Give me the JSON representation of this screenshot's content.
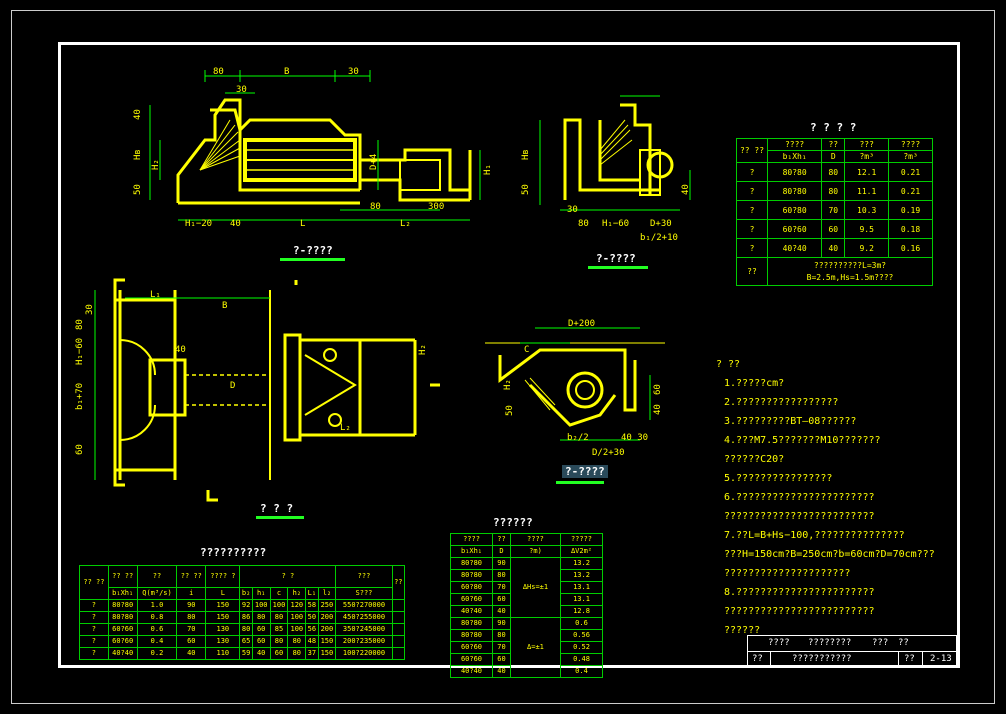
{
  "colors": {
    "line": "#ffff00",
    "dim": "#00ff00",
    "frame": "#ffffff",
    "accent": "#33ff33"
  },
  "views": {
    "elevation_label": "?-????",
    "side_label": "?-????",
    "plan_label": "? ? ?",
    "section_label": "?-????"
  },
  "dims": {
    "top_80": "80",
    "top_B": "B",
    "top_30a": "30",
    "top_30b": "30",
    "left_40": "40",
    "left_50": "50",
    "Hb": "Hв",
    "H2": "H₂",
    "H1": "H₁",
    "D4": "D+4",
    "Hl20": "H₁−20",
    "v40": "40",
    "L": "L",
    "L2": "L₂",
    "v80": "80",
    "v300": "300",
    "s_Hb": "Hв",
    "s_50": "50",
    "s_30": "30",
    "s_80": "80",
    "s_H60": "H₁−60",
    "s_D30": "D+30",
    "s_b2": "b₁/2+10",
    "s_40": "40",
    "p_80": "80",
    "p_30": "30",
    "p_60": "60",
    "p_L1": "L₁",
    "p_B": "B",
    "p_b70": "b₁+70",
    "p_H60": "H₁−60",
    "p_D": "D",
    "p_40": "40",
    "p_H2": "H₂",
    "p_L2": "L₂",
    "x_D200": "D+200",
    "x_C": "C",
    "x_H2": "H₂",
    "x_50": "50",
    "x_60": "60",
    "x_40": "40",
    "x_b2": "b₂/2",
    "x_4030": "40 30",
    "x_D230": "D/2+30"
  },
  "table_tr": {
    "title": "? ? ? ?",
    "headers": [
      "????",
      "??",
      "???",
      "????"
    ],
    "header_left": "??\n??",
    "subheaders": [
      "b₁Xh₁",
      "D",
      "?m³",
      "?m³"
    ],
    "rows": [
      [
        "?",
        "80?80",
        "80",
        "12.1",
        "0.21"
      ],
      [
        "?",
        "80?80",
        "80",
        "11.1",
        "0.21"
      ],
      [
        "?",
        "60?80",
        "70",
        "10.3",
        "0.19"
      ],
      [
        "?",
        "60?60",
        "60",
        "9.5",
        "0.18"
      ],
      [
        "?",
        "40?40",
        "40",
        "9.2",
        "0.16"
      ]
    ],
    "foot_label": "??",
    "foot_note1": "??????????L=3m?",
    "foot_note2": "B=2.5m,Hs=1.5m????"
  },
  "notes": {
    "title": "?  ??",
    "lines": [
      "1.?????cm?",
      "2.?????????????????",
      "3.?????????BT—08??????",
      "4.???M7.5???????M10???????",
      "  ??????C20?",
      "5.????????????????",
      "6.???????????????????????",
      "  ?????????????????????????",
      "7.??L=B+Hs−100,???????????????",
      "  ???H=150cm?B=250cm?b=60cm?D=70cm???",
      "  ?????????????????????",
      "8.???????????????????????",
      "  ?????????????????????????",
      "  ??????"
    ]
  },
  "table_bl": {
    "title": "??????????",
    "head1": [
      "??\n??",
      "??\n??",
      "??",
      "??\n??",
      "???? ?",
      "? ?",
      "???",
      "??"
    ],
    "head2": [
      "b₁Xh₁",
      "Q(m³/s)",
      "i",
      "L",
      "h₂",
      "b₂",
      "h₁",
      "c",
      "h₂",
      "L₁",
      "l₂",
      "S???"
    ],
    "rows": [
      [
        "?",
        "80?80",
        "1.0",
        "90",
        "150",
        "92",
        "100",
        "100",
        "120",
        "58",
        "250",
        "550?270000"
      ],
      [
        "?",
        "80?80",
        "0.8",
        "80",
        "150",
        "86",
        "80",
        "80",
        "100",
        "50",
        "200",
        "450?255000"
      ],
      [
        "?",
        "60?60",
        "0.6",
        "70",
        "130",
        "80",
        "60",
        "85",
        "100",
        "56",
        "200",
        "350?245000"
      ],
      [
        "?",
        "60?60",
        "0.4",
        "60",
        "130",
        "65",
        "60",
        "80",
        "80",
        "48",
        "150",
        "200?235000"
      ],
      [
        "?",
        "40?40",
        "0.2",
        "40",
        "110",
        "59",
        "40",
        "60",
        "80",
        "37",
        "150",
        "100?220000"
      ]
    ]
  },
  "table_bm": {
    "title": "??????",
    "headers": [
      "????",
      "??",
      "????",
      "?????"
    ],
    "subheaders": [
      "b₁Xh₁",
      "D",
      "?m)",
      "ΔV2m²"
    ],
    "group1": "ΔHs=±1",
    "group2": "Δ=±1",
    "rows": [
      [
        "80?80",
        "90",
        "13.2"
      ],
      [
        "80?80",
        "80",
        "13.2"
      ],
      [
        "60?80",
        "70",
        "13.1"
      ],
      [
        "60?60",
        "60",
        "13.1"
      ],
      [
        "40?40",
        "40",
        "12.8"
      ],
      [
        "80?80",
        "90",
        "0.6"
      ],
      [
        "80?80",
        "80",
        "0.56"
      ],
      [
        "60?60",
        "70",
        "0.52"
      ],
      [
        "60?60",
        "60",
        "0.48"
      ],
      [
        "40?40",
        "40",
        "0.4"
      ]
    ]
  },
  "titleblock": {
    "r1a": "????",
    "r1b": "????????",
    "r1c": "???",
    "r1d": "??",
    "r2a": "??",
    "r2b": "???????????",
    "r2c": "??",
    "r2d": "2-13"
  }
}
